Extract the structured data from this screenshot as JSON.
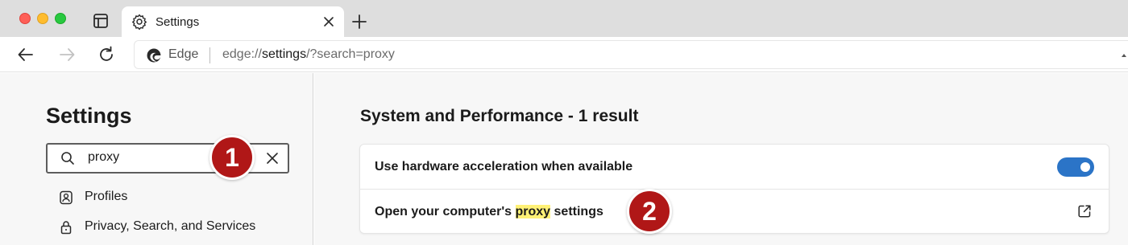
{
  "tab": {
    "title": "Settings"
  },
  "address": {
    "site_label": "Edge",
    "url_scheme": "edge://",
    "url_host": "settings",
    "url_rest": "/?search=proxy"
  },
  "sidebar": {
    "title": "Settings",
    "search": {
      "value": "proxy"
    },
    "items": [
      {
        "label": "Profiles",
        "icon": "profile-icon"
      },
      {
        "label": "Privacy, Search, and Services",
        "icon": "lock-icon"
      }
    ]
  },
  "main": {
    "section_title": "System and Performance - 1 result",
    "settings": [
      {
        "label": "Use hardware acceleration when available",
        "control": "toggle",
        "enabled": true
      },
      {
        "label_before": "Open your computer's ",
        "label_highlight": "proxy",
        "label_after": " settings",
        "control": "external-link-icon"
      }
    ]
  },
  "callouts": {
    "first": "1",
    "second": "2"
  },
  "colors": {
    "accent": "#2b74c7",
    "highlight": "#fff176",
    "callout": "#b01717",
    "tab_strip": "#dedede",
    "page_bg": "#f7f7f7"
  }
}
